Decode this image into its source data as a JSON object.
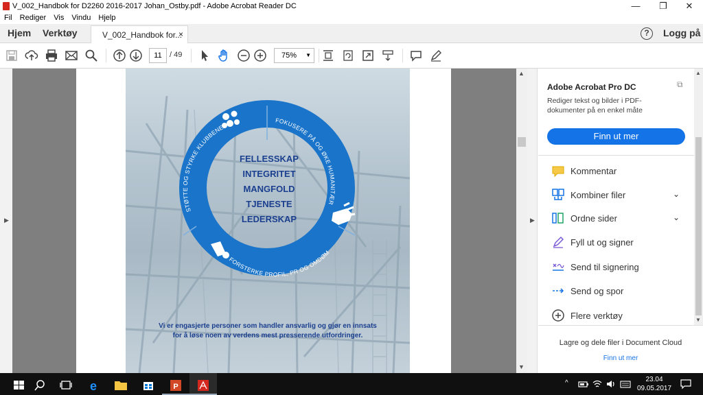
{
  "window": {
    "title": "V_002_Handbok for D2260 2016-2017 Johan_Ostby.pdf - Adobe Acrobat Reader DC",
    "minimize": "—",
    "restore": "❐",
    "close": "✕"
  },
  "menu": [
    "Fil",
    "Rediger",
    "Vis",
    "Vindu",
    "Hjelp"
  ],
  "tabs": {
    "home": "Hjem",
    "tools": "Verktøy",
    "doc": "V_002_Handbok for...",
    "close": "×"
  },
  "header": {
    "help": "?",
    "login": "Logg på"
  },
  "toolbar": {
    "page_current": "11",
    "page_total": "/ 49",
    "zoom": "75%",
    "zoom_arrow": "▼",
    "icons": [
      "save-icon",
      "upload-icon",
      "print-icon",
      "email-icon",
      "search-icon",
      "prev-page-icon",
      "next-page-icon",
      "select-icon",
      "hand-icon",
      "zoom-out-icon",
      "zoom-in-icon",
      "fit-page-icon",
      "rotate-icon",
      "fullscreen-icon",
      "scroll-mode-icon",
      "comment-icon",
      "sign-icon"
    ]
  },
  "document": {
    "ring_values": [
      "FELLESSKAP",
      "INTEGRITET",
      "MANGFOLD",
      "TJENESTE",
      "LEDERSKAP"
    ],
    "ring_segments": [
      "FOKUSERE PÅ OG ØKE HUMANITÆR TJENESTE",
      "FORSTERKE PROFIL, PR OG OMDØMME",
      "STØTTE OG STYRKE KLUBBENE"
    ],
    "caption_line1": "Vi er engasjerte personer som handler ansvarlig og gjør en innsats",
    "caption_line2": "for å løse noen av verdens mest presserende utfordringer.",
    "colors": {
      "ring": "#1a74c9",
      "ring_text": "#ffffff",
      "values_text": "#1b3f8f",
      "caption_text": "#1b3f8f"
    }
  },
  "right_panel": {
    "promo_title": "Adobe Acrobat Pro DC",
    "promo_text": "Rediger tekst og bilder i PDF-dokumenter på en enkel måte",
    "promo_button": "Finn ut mer",
    "tools": [
      {
        "label": "Kommentar",
        "icon": "comment-icon",
        "chevron": ""
      },
      {
        "label": "Kombiner filer",
        "icon": "combine-files-icon",
        "chevron": "⌄"
      },
      {
        "label": "Ordne sider",
        "icon": "organize-pages-icon",
        "chevron": "⌄"
      },
      {
        "label": "Fyll ut og signer",
        "icon": "fill-sign-icon",
        "chevron": ""
      },
      {
        "label": "Send til signering",
        "icon": "send-for-signature-icon",
        "chevron": ""
      },
      {
        "label": "Send og spor",
        "icon": "send-track-icon",
        "chevron": ""
      },
      {
        "label": "Flere verktøy",
        "icon": "more-tools-icon",
        "chevron": ""
      }
    ],
    "footer_text": "Lagre og dele filer i Document Cloud",
    "footer_link": "Finn ut mer"
  },
  "taskbar": {
    "time": "23.04",
    "date": "09.05.2017",
    "tray_arrow": "^"
  }
}
